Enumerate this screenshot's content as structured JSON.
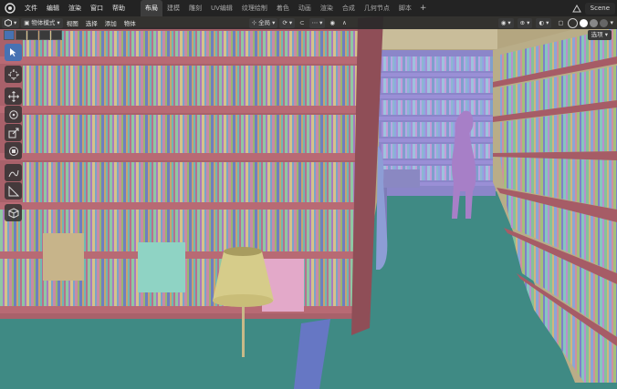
{
  "topbar": {
    "menus": [
      "文件",
      "编辑",
      "渲染",
      "窗口",
      "帮助"
    ],
    "workspaces": [
      "布局",
      "建模",
      "雕刻",
      "UV编辑",
      "纹理绘制",
      "着色",
      "动画",
      "渲染",
      "合成",
      "几何节点",
      "脚本"
    ],
    "active_workspace": "布局",
    "add_tab": "+",
    "scene_name": "Scene"
  },
  "header": {
    "editor_type_icon": "cube-icon",
    "mode": "物体模式",
    "menus": [
      "视图",
      "选择",
      "添加",
      "物体"
    ],
    "transform_orientation": "全局",
    "options_label": "选项"
  },
  "toolbar": {
    "tools": [
      "select-box-icon",
      "cursor-icon",
      "move-icon",
      "rotate-icon",
      "scale-icon",
      "transform-icon",
      "annotate-icon",
      "measure-icon",
      "add-cube-icon"
    ],
    "active_tool": "select-box-icon"
  },
  "colors": {
    "floor": "#3f8a84",
    "wall": "#b7a985",
    "shelf": "#a9616a",
    "accent": "#4772b3"
  }
}
